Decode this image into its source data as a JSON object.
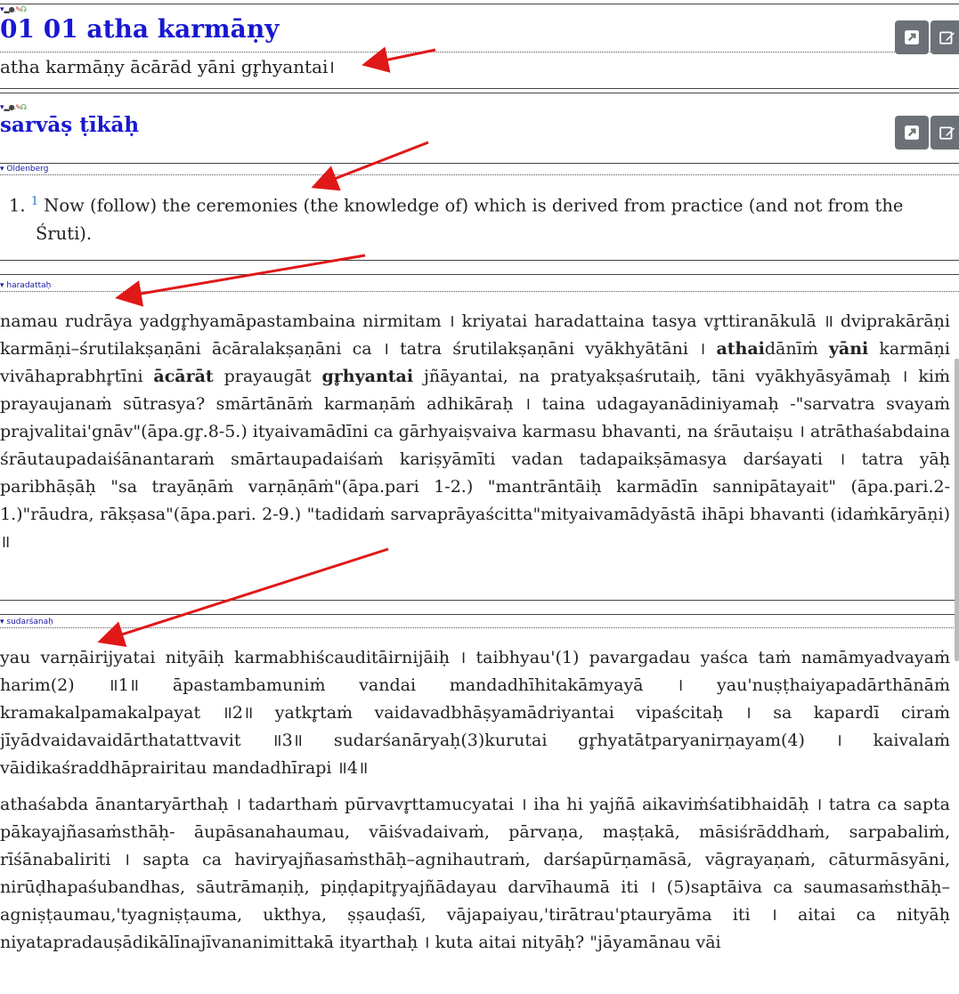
{
  "sutra": {
    "title": "01 01 atha karmāṇy",
    "text": "atha karmāṇy ācārād yāni gr̥hyantai।"
  },
  "commentary_header": {
    "title": "sarvāṣ ṭīkāḥ"
  },
  "oldenberg": {
    "tag": "▾ Oldenberg",
    "number": "1.",
    "footnote": "1",
    "text": "Now (follow) the ceremonies (the knowledge of) which is derived from practice (and not from the Śruti)."
  },
  "haradatta": {
    "tag": "▾ haradattaḥ",
    "p1a": "namau rudrāya yadgr̥hyamāpastambaina nirmitam । kriyatai haradattaina tasya vr̥ttiranākulā ॥ dviprakārāṇi karmāṇi–śrutilakṣaṇāni ācāralakṣaṇāni ca । tatra śrutilakṣaṇāni vyākhyātāni । ",
    "b1": "athai",
    "p1b": "dānīṁ ",
    "b2": "yāni",
    "p1c": " karmāṇi vivāhaprabhr̥tīni ",
    "b3": "ācārāt",
    "p1d": " prayaugāt ",
    "b4": "gr̥hyantai",
    "p1e": " jñāyantai, na pratyakṣaśrutaiḥ, tāni vyākhyāsyāmaḥ । kiṁ prayaujanaṁ sūtrasya? smārtānāṁ karmaṇāṁ adhikāraḥ । taina udagayanādiniyamaḥ -\"sarvatra svayaṁ prajvalitai'gnāv\"(āpa.gr̥.8-5.) ityaivamādīni ca gārhyaiṣvaiva karmasu bhavanti, na śrāutaiṣu । atrāthaśabdaina śrāutaupadaiśānantaraṁ smārtaupadaiśaṁ kariṣyāmīti vadan tadapaikṣāmasya darśayati । tatra yāḥ paribhāṣāḥ \"sa trayāṇāṁ varṇāṇāṁ\"(āpa.pari 1-2.) \"mantrāntāiḥ karmādīn sannipātayait\" (āpa.pari.2-1.)\"rāudra, rākṣasa\"(āpa.pari. 2-9.) \"tadidaṁ sarvaprāyaścitta\"mityaivamādyāstā ihāpi bhavanti (idaṁkāryāṇi) ॥"
  },
  "sudarshana": {
    "tag": "▾ sudarśanaḥ",
    "p1": "yau varṇāirijyatai nityāiḥ karmabhiścauditāirnijāiḥ । taibhyau'(1) pavargadau yaśca taṁ namāmyadvayaṁ harim(2) ॥1॥ āpastambamuniṁ vandai mandadhīhitakāmyayā । yau'nuṣṭhaiyapadārthānāṁ kramakalpamakalpayat ॥2॥ yatkr̥taṁ vaidavadbhāṣyamādriyantai vipaścitaḥ । sa kapardī ciraṁ jīyādvaidavaidārthatattvavit ॥3॥ sudarśanāryaḥ(3)kurutai gr̥hyatātparyanirṇayam(4) । kaivalaṁ vāidikaśraddhāprairitau mandadhīrapi ॥4॥",
    "p2": "athaśabda ānantaryārthaḥ । tadarthaṁ pūrvavr̥ttamucyatai । iha hi yajñā aikaviṁśatibhaidāḥ । tatra ca sapta pākayajñasaṁsthāḥ- āupāsanahaumau, vāiśvadaivaṁ, pārvaṇa, maṣṭakā, māsiśrāddhaṁ, sarpabaliṁ, rīśānabaliriti । sapta ca haviryajñasaṁsthāḥ–agnihautraṁ, darśapūrṇamāsā, vāgrayaṇaṁ, cāturmāsyāni, nirūḍhapaśubandhas, sāutrāmaṇiḥ, piṇḍapitr̥yajñādayau darvīhaumā iti । (5)saptāiva ca saumasaṁsthāḥ–agniṣṭaumau,'tyagniṣṭauma, ukthya, ṣṣauḍaśī, vājapaiyau,'tirātrau'ptauryāma iti । aitai ca nityāḥ niyatapradauṣādikālīnajīvananimittakā ityarthaḥ । kuta aitai nityāḥ? \"jāyamānau vāi"
  },
  "icons": [
    "open-external-icon",
    "edit-icon"
  ],
  "colors": {
    "title": "#1818d0",
    "button": "#6b7177",
    "arrow": "#e01818"
  }
}
